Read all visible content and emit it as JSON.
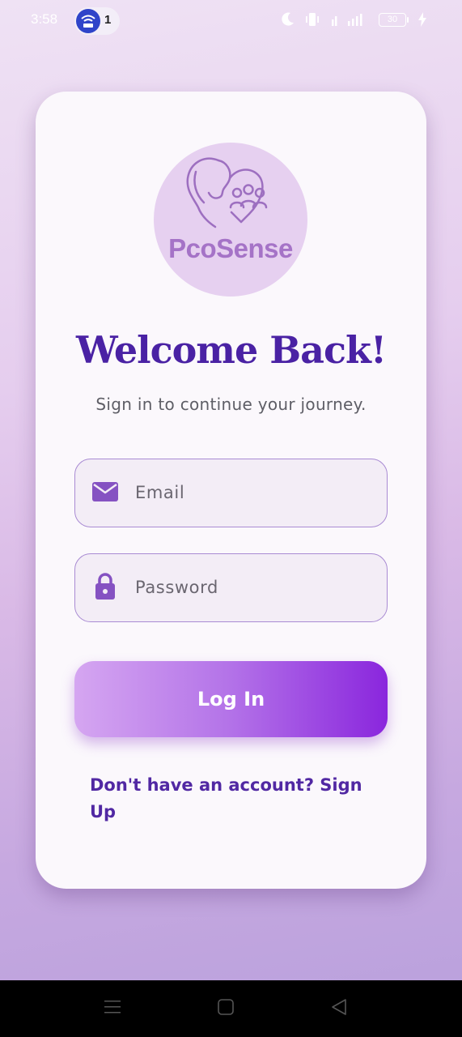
{
  "status_bar": {
    "time": "3:58",
    "notification_count": "1",
    "battery_level": "30",
    "icons": [
      "hotspot-icon",
      "moon-icon",
      "vibrate-icon",
      "signal-icon",
      "battery-icon",
      "charging-icon"
    ]
  },
  "logo": {
    "text": "PcoSense",
    "color": "#a573c7"
  },
  "login": {
    "title": "Welcome Back!",
    "subtitle": "Sign in to continue your journey.",
    "email_placeholder": "Email",
    "password_placeholder": "Password",
    "login_button": "Log In",
    "signup_link": "Don't have an account? Sign Up"
  },
  "colors": {
    "title": "#4a22a4",
    "accent": "#8a26dd",
    "field_border": "#a98bd3",
    "link": "#5128a3"
  },
  "nav_bar": {
    "icons": [
      "menu-icon",
      "home-icon",
      "back-icon"
    ]
  }
}
